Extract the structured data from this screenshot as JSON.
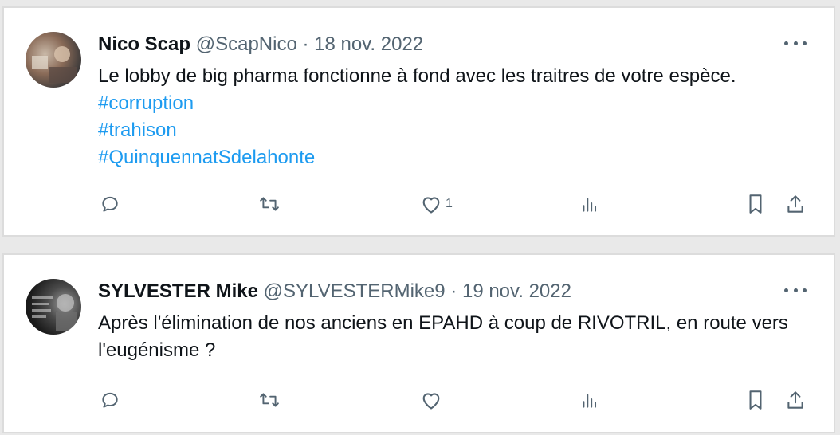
{
  "tweets": [
    {
      "author_name": "Nico Scap",
      "handle": "@ScapNico",
      "separator": "·",
      "date": "18 nov. 2022",
      "text": "Le lobby de big pharma fonctionne à fond avec les traitres de votre espèce.",
      "hashtags": [
        "#corruption",
        "#trahison",
        "#QuinquennatSdelahonte"
      ],
      "like_count": "1",
      "more_label": "···"
    },
    {
      "author_name": "SYLVESTER Mike",
      "handle": "@SYLVESTERMike9",
      "separator": "·",
      "date": "19 nov. 2022",
      "text": "Après l'élimination de nos anciens en EPAHD à coup de RIVOTRIL, en route vers l'eugénisme ?",
      "hashtags": [],
      "like_count": "",
      "more_label": "···"
    }
  ],
  "icons": {
    "reply": "reply-icon",
    "retweet": "retweet-icon",
    "like": "heart-icon",
    "views": "views-icon",
    "bookmark": "bookmark-icon",
    "share": "share-icon",
    "more": "more-icon"
  },
  "colors": {
    "link": "#1d9bf0",
    "secondary_text": "#536471",
    "primary_text": "#0f1419"
  }
}
